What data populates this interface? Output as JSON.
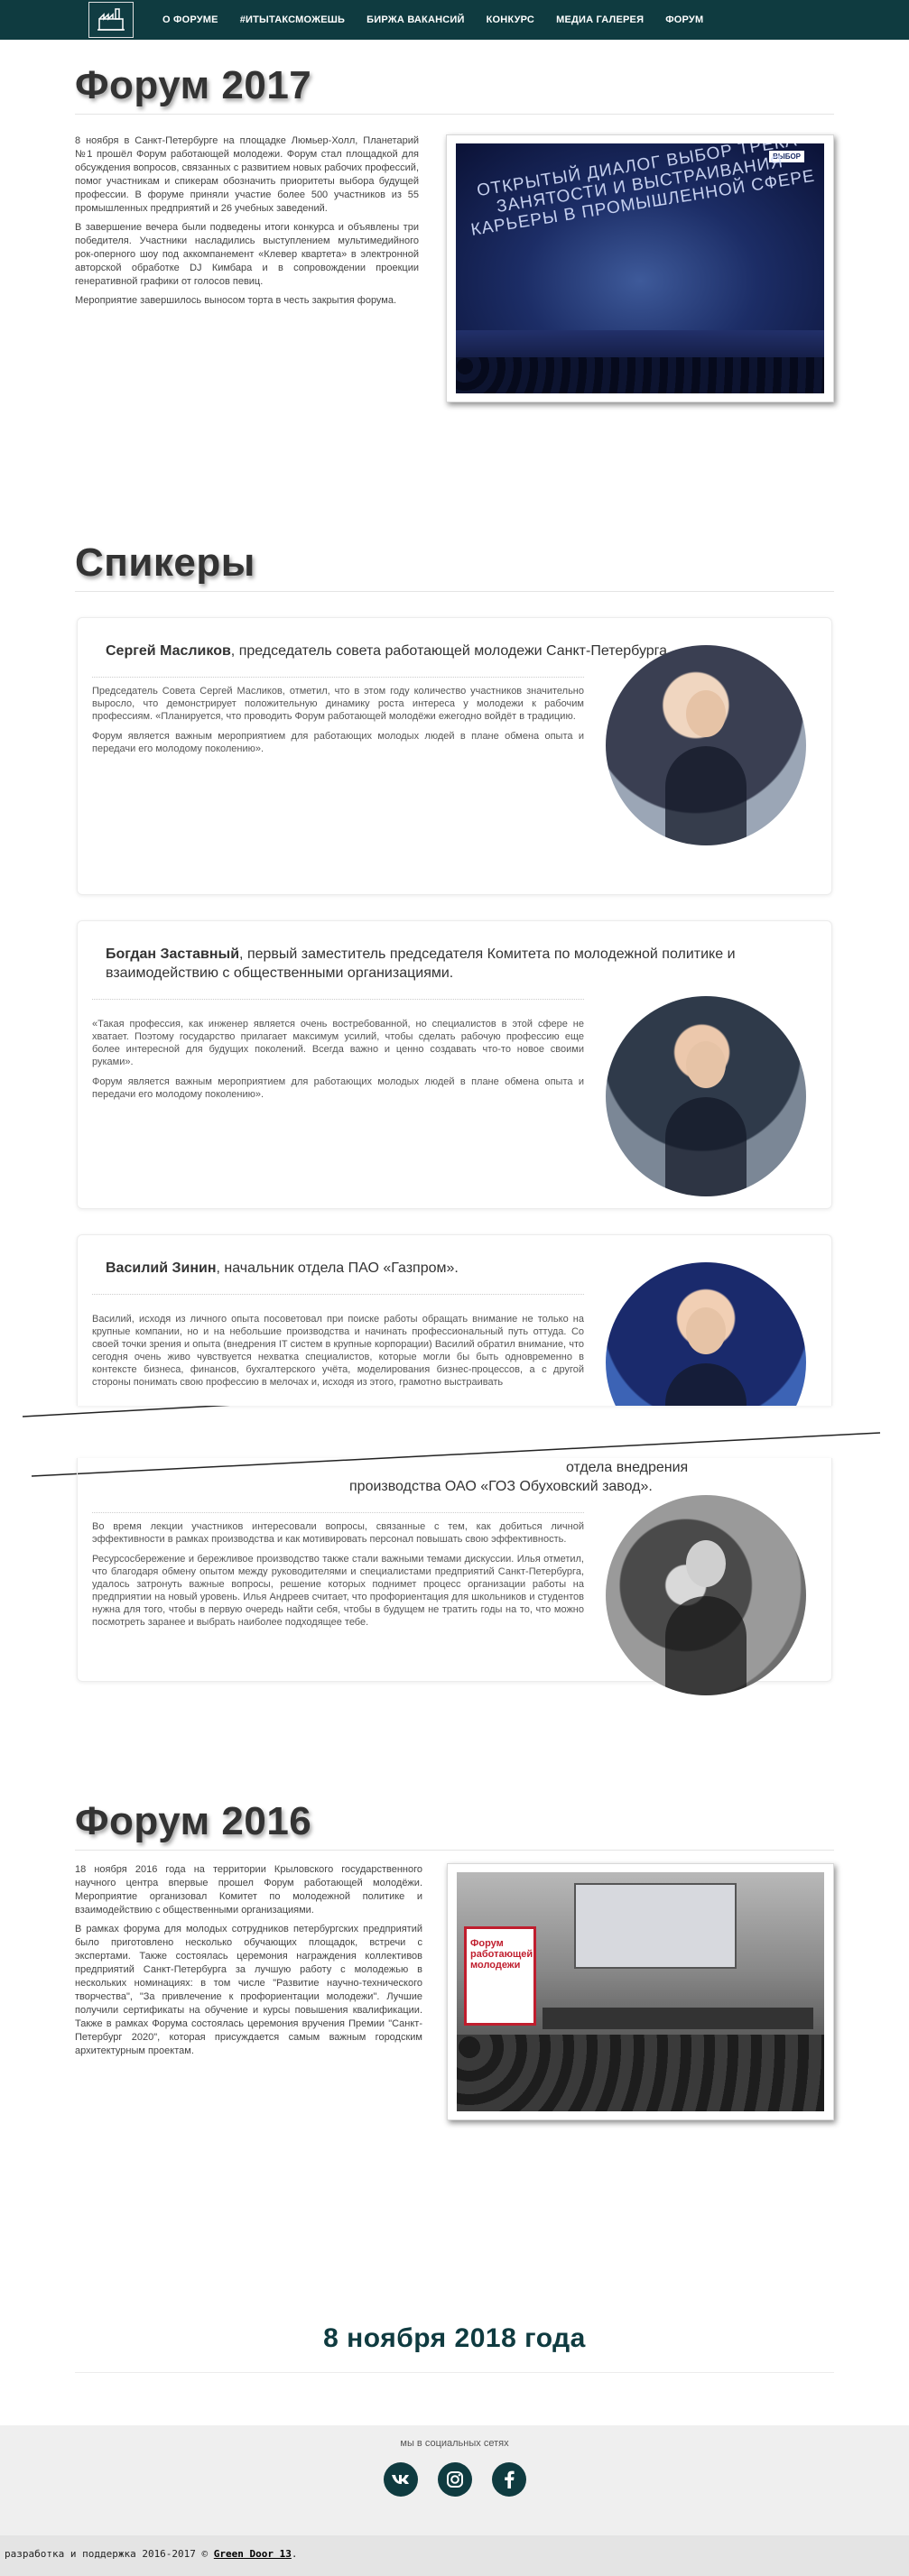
{
  "nav": {
    "items": [
      {
        "label": "О ФОРУМЕ"
      },
      {
        "label": "#ИТЫТАКСМОЖЕШЬ"
      },
      {
        "label": "БИРЖА ВАКАНСИЙ"
      },
      {
        "label": "КОНКУРС"
      },
      {
        "label": "МЕДИА ГАЛЕРЕЯ"
      },
      {
        "label": "ФОРУМ"
      }
    ]
  },
  "forum2017": {
    "title": "Форум 2017",
    "paragraphs": [
      "8 ноября в Санкт-Петербурге на площадке Люмьер-Холл, Планетарий №1 прошёл Форум работающей молодежи. Форум стал площадкой для обсуждения вопросов, связанных с развитием новых рабочих профессий, помог участникам и спикерам обозначить приоритеты выбора будущей профессии. В форуме приняли участие более 500 участников из 55 промышленных предприятий и 26 учебных заведений.",
      "В завершение вечера были подведены итоги конкурса и объявлены три победителя. Участники насладились выступлением мультимедийного рок-оперного шоу под аккомпанемент «Клевер квартета» в электронной авторской обработке DJ Кимбара и в сопровождении проекции генеративной графики от голосов певиц.",
      "Мероприятие завершилось выносом торта в честь закрытия форума."
    ],
    "photo_text": "ОТКРЫТЫЙ ДИАЛОГ ВЫБОР ТРЕКА ЗАНЯТОСТИ И ВЫСТРАИВАНИЯ КАРЬЕРЫ В ПРОМЫШЛЕННОЙ СФЕРЕ"
  },
  "speakers": {
    "title": "Спикеры",
    "items": [
      {
        "name": "Сергей Масликов",
        "role": ", председатель совета работающей молодежи Санкт-Петербурга",
        "paragraphs": [
          "Председатель Совета Сергей Масликов, отметил, что в этом году количество участников значительно выросло, что демонстрирует положительную динамику роста интереса у молодежи к рабочим профессиям. «Планируется, что проводить Форум работающей молодёжи ежегодно войдёт в традицию.",
          "Форум является важным мероприятием для работающих молодых людей в плане обмена опыта и передачи его молодому поколению»."
        ]
      },
      {
        "name": "Богдан Заставный",
        "role": ", первый заместитель председателя Комитета по молодежной политике и взаимодействию с общественными организациями.",
        "paragraphs": [
          "«Такая профессия, как инженер является очень востребованной, но специалистов в этой сфере не хватает. Поэтому государство прилагает максимум усилий, чтобы сделать рабочую профессию еще более интересной для будущих поколений. Всегда важно и ценно создавать что-то новое своими руками».",
          "Форум является важным мероприятием для работающих молодых людей в плане обмена опыта и передачи его молодому поколению»."
        ]
      },
      {
        "name": "Василий Зинин",
        "role": ", начальник отдела ПАО «Газпром».",
        "paragraphs": [
          "Василий, исходя из личного опыта посоветовал при поиске работы обращать внимание не только на крупные компании, но и на небольшие производства и начинать профессиональный путь оттуда. Со своей точки зрения и опыта (внедрения IT систем в крупные корпорации) Василий обратил внимание, что сегодня очень живо чувствуется нехватка специалистов, которые могли бы быть одновременно в контексте бизнеса, финансов, бухгалтерского учёта, моделирования бизнес-процессов, а с другой стороны понимать свою профессию в мелочах и, исходя из этого, грамотно выстраивать"
        ]
      },
      {
        "name": "",
        "role": "отдела внедрения",
        "role2": "производства ОАО «ГОЗ Обуховский завод».",
        "paragraphs": [
          "Во время лекции участников интересовали вопросы, связанные с тем, как добиться личной эффективности в рамках производства и как мотивировать персонал повышать свою эффективность.",
          "Ресурсосбережение и бережливое производство также стали важными темами дискуссии. Илья отметил, что благодаря обмену опытом между руководителями и специалистами предприятий Санкт-Петербурга, удалось затронуть важные вопросы, решение которых поднимет процесс организации работы на предприятии на новый уровень. Илья Андреев считает, что профориентация для школьников и студентов нужна для того, чтобы в первую очередь найти себя, чтобы в будущем не тратить годы на то, что можно посмотреть заранее и выбрать наиболее подходящее тебе."
        ]
      }
    ]
  },
  "forum2016": {
    "title": "Форум 2016",
    "paragraphs": [
      "18 ноября 2016 года на территории Крыловского государственного научного центра впервые прошел Форум работающей молодёжи. Мероприятие организовал Комитет по молодежной политике и взаимодействию с общественными организациями.",
      "В рамках форума для молодых сотрудников петербургских предприятий было приготовлено несколько обучающих площадок, встречи с экспертами. Также состоялась церемония награждения коллективов предприятий Санкт-Петербурга за лучшую работу с молодежью в нескольких номинациях: в том числе \"Развитие научно-технического творчества\", \"За привлечение к профориентации молодежи\". Лучшие получили сертификаты на обучение и курсы повышения квалификации. Также в рамках Форума состоялась церемония вручения Премии \"Санкт-Петербург 2020\", которая присуждается самым важным городским архитектурным проектам."
    ],
    "photo_banner": "Форум работающей молодежи"
  },
  "event_date": "8 ноября 2018 года",
  "footer": {
    "social_caption": "мы в социальных сетях",
    "socials": [
      {
        "icon": "vk-icon",
        "glyph": "vk"
      },
      {
        "icon": "instagram-icon",
        "glyph": ""
      },
      {
        "icon": "facebook-icon",
        "glyph": "f"
      }
    ],
    "copyright_prefix": "разработка и поддержка 2016-2017 © ",
    "copyright_link": "Green Door 13",
    "copyright_suffix": "."
  },
  "colors": {
    "navbar": "#0f3b40",
    "heading": "#333333",
    "date": "#0f3b40",
    "social_circle": "#0f3b40"
  }
}
